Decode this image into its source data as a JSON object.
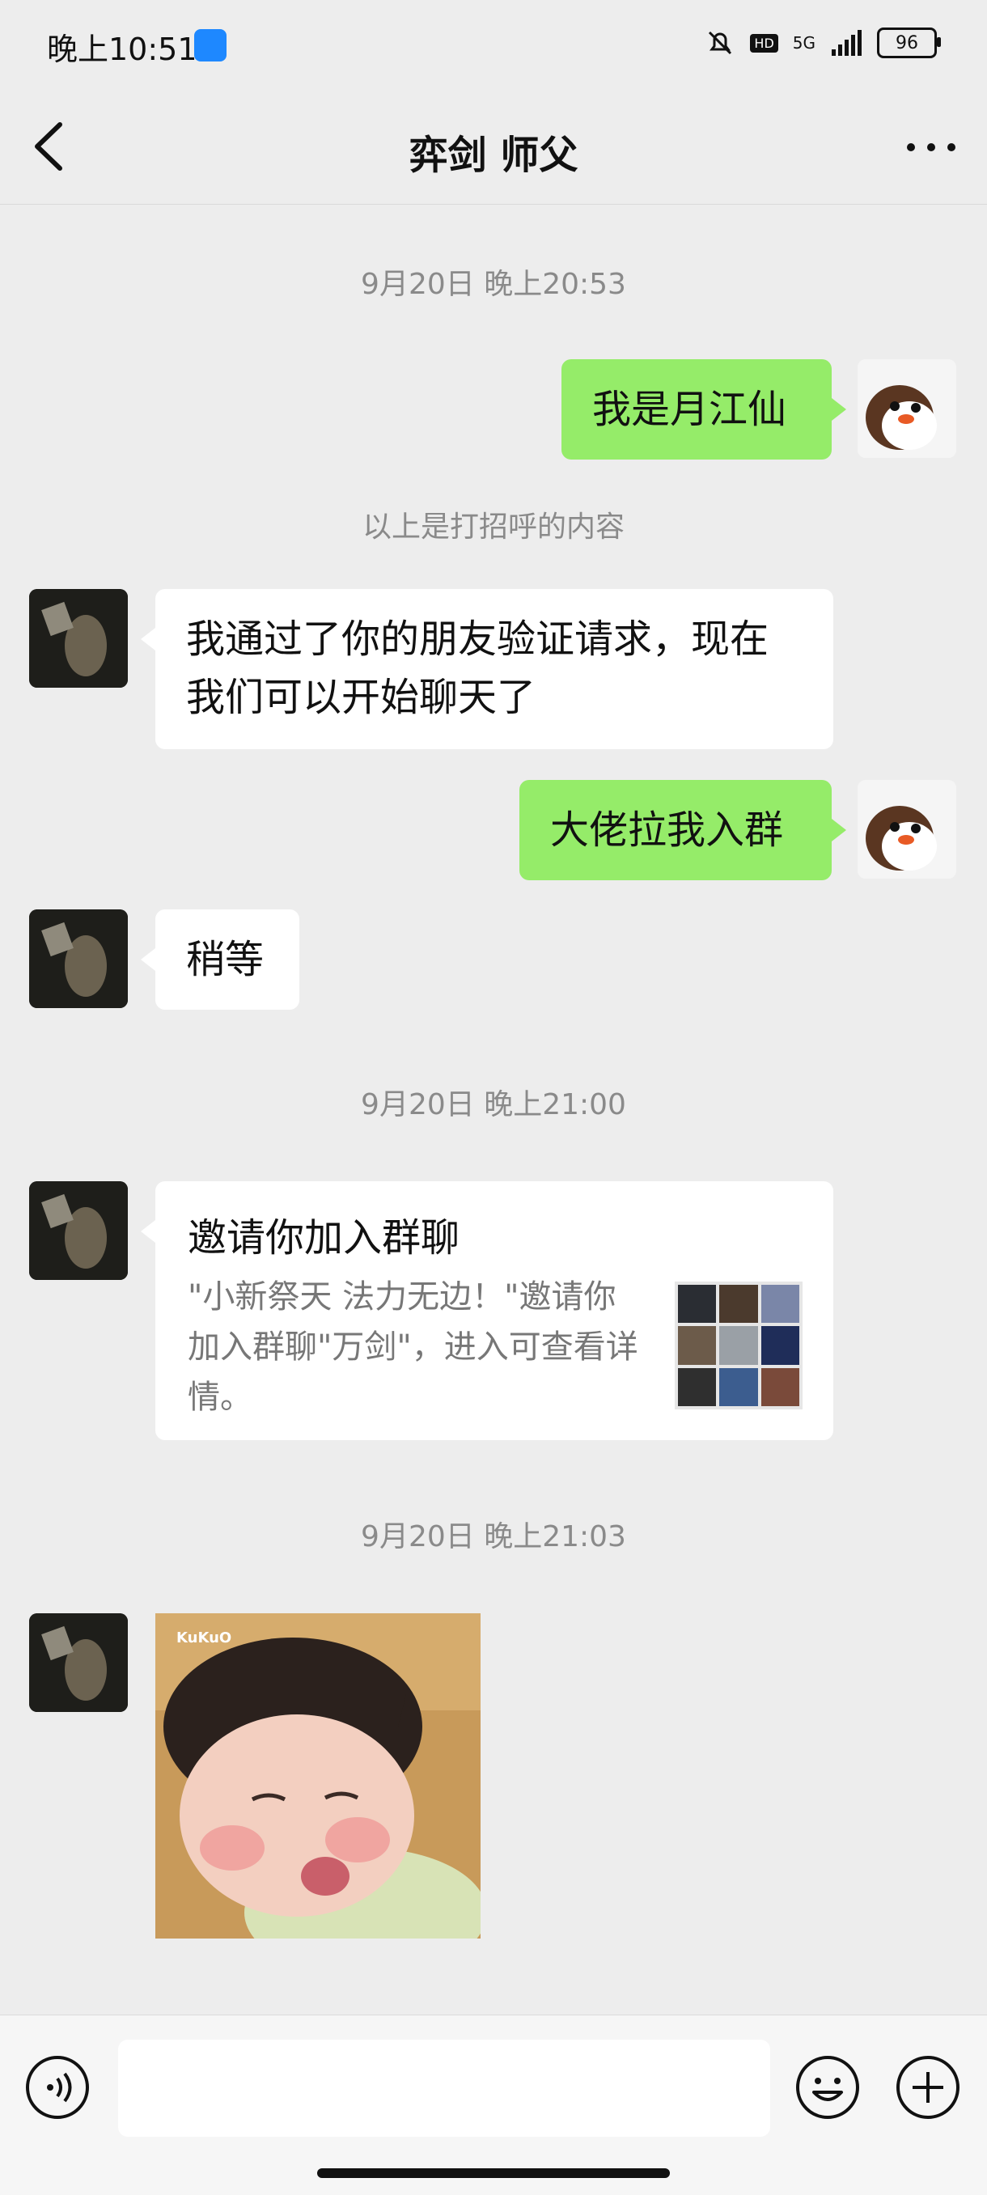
{
  "status_bar": {
    "time": "晚上10:51",
    "battery": "96",
    "network": "5G",
    "hd": "HD"
  },
  "header": {
    "title": "弈剑  师父",
    "back_icon": "chevron-left-icon",
    "more_icon": "more-dots-icon"
  },
  "messages": {
    "ts1": "9月20日 晚上20:53",
    "m1": "我是月江仙",
    "sys": "以上是打招呼的内容",
    "m2": "我通过了你的朋友验证请求，现在我们可以开始聊天了",
    "m3": "大佬拉我入群",
    "m4": "稍等",
    "ts2": "9月20日 晚上21:00",
    "card_title": "邀请你加入群聊",
    "card_desc": "\"小新祭天 法力无边！\"邀请你加入群聊\"万剑\"，进入可查看详情。",
    "ts3": "9月20日 晚上21:03",
    "sticker_text": "KuKuO"
  },
  "input_bar": {
    "voice_icon": "voice-icon",
    "emoji_icon": "emoji-icon",
    "plus_icon": "plus-icon"
  },
  "colors": {
    "self_bubble": "#95ec69",
    "other_bubble": "#ffffff",
    "background": "#ededed"
  }
}
